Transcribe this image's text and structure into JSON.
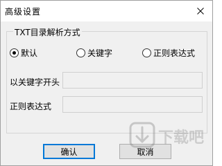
{
  "window": {
    "title": "高级设置",
    "close_icon": "close-icon"
  },
  "group": {
    "legend": "TXT目录解析方式",
    "options": [
      {
        "label": "默认",
        "selected": true
      },
      {
        "label": "关键字",
        "selected": false
      },
      {
        "label": "正则表达式",
        "selected": false
      }
    ]
  },
  "fields": {
    "keyword_prefix_label": "以关键字开头",
    "keyword_prefix_value": "",
    "regex_label": "正则表达式",
    "regex_value": ""
  },
  "buttons": {
    "ok_label": "确认",
    "cancel_label": "取消"
  },
  "watermark": {
    "text": "下载吧"
  }
}
